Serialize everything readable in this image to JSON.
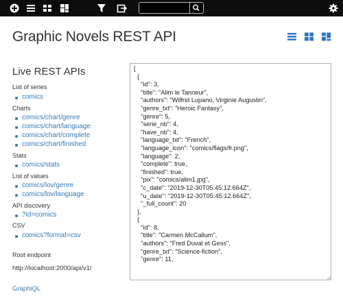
{
  "toolbar": {
    "icons": [
      "add-icon",
      "list-view-icon",
      "cards-view-icon",
      "dashboard-view-icon",
      "filter-icon",
      "export-icon",
      "search-icon",
      "gear-icon"
    ],
    "search_value": ""
  },
  "page": {
    "title": "Graphic Novels REST API",
    "section_title": "Live REST APIs"
  },
  "groups": [
    {
      "label": "List of series",
      "links": [
        "comics"
      ]
    },
    {
      "label": "Charts",
      "links": [
        "comics/chart/genre",
        "comics/chart/language",
        "comics/chart/complete",
        "comics/chart/finished"
      ]
    },
    {
      "label": "Stats",
      "links": [
        "comics/stats"
      ]
    },
    {
      "label": "List of values",
      "links": [
        "comics/lov/genre",
        "comics/lov/language"
      ]
    },
    {
      "label": "API discovery",
      "links": [
        "?id=comics"
      ]
    },
    {
      "label": "CSV",
      "links": [
        "comics?format=csv"
      ]
    }
  ],
  "endpoint": {
    "label": "Root endpoint",
    "url": "http://localhost:2000/api/v1/"
  },
  "graphiql_label": "GraphiQL",
  "json_lines": [
    "[",
    "  {",
    "    \"id\": 3,",
    "    \"title\": \"Alim le Tanneur\",",
    "    \"authors\": \"Wilfrid Lupano, Virginie Augustin\",",
    "    \"genre_txt\": \"Heroic Fantasy\",",
    "    \"genre\": 5,",
    "    \"serie_nb\": 4,",
    "    \"have_nb\": 4,",
    "    \"language_txt\": \"French\",",
    "    \"language_icon\": \"comics/flags/fr.png\",",
    "    \"language\": 2,",
    "    \"complete\": true,",
    "    \"finished\": true,",
    "    \"pix\": \"comics/alim1.jpg\",",
    "    \"c_date\": \"2019-12-30T05:45:12.664Z\",",
    "    \"u_date\": \"2019-12-30T05:45:12.664Z\",",
    "    \"_full_count\": 20",
    "  },",
    "  {",
    "    \"id\": 8,",
    "    \"title\": \"Carmen McCallum\",",
    "    \"authors\": \"Fred Duval et Gess\",",
    "    \"genre_txt\": \"Science-fiction\",",
    "    \"genre\": 11,"
  ],
  "colors": {
    "toolbar_bg": "#0c0c0c",
    "link": "#337ab7",
    "view_icon": "#2f74c0"
  }
}
